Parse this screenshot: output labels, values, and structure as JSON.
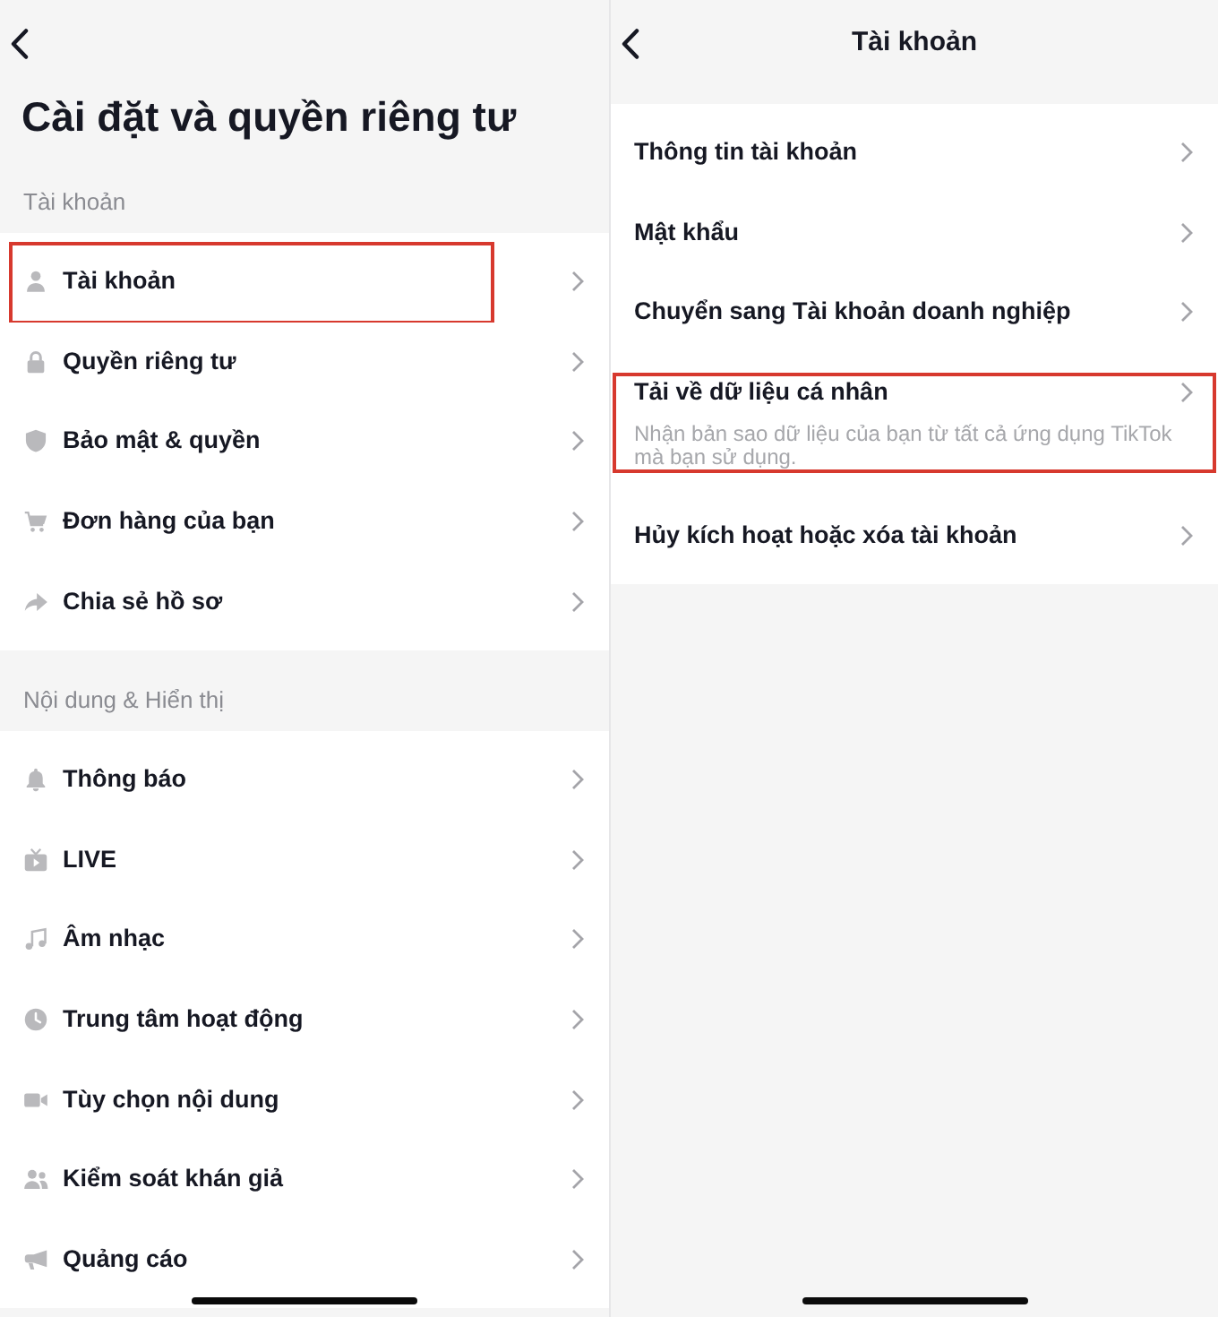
{
  "left_screen": {
    "title": "Cài đặt và quyền riêng tư",
    "sections": [
      {
        "header": "Tài khoản",
        "items": [
          {
            "kind": "account",
            "label": "Tài khoản",
            "highlighted": true
          },
          {
            "kind": "privacy",
            "label": "Quyền riêng tư",
            "highlighted": false
          },
          {
            "kind": "security",
            "label": "Bảo mật & quyền",
            "highlighted": false
          },
          {
            "kind": "orders",
            "label": "Đơn hàng của bạn",
            "highlighted": false
          },
          {
            "kind": "share",
            "label": "Chia sẻ hồ sơ",
            "highlighted": false
          }
        ]
      },
      {
        "header": "Nội dung & Hiển thị",
        "items": [
          {
            "kind": "notifications",
            "label": "Thông báo",
            "highlighted": false
          },
          {
            "kind": "live",
            "label": "LIVE",
            "highlighted": false
          },
          {
            "kind": "music",
            "label": "Âm nhạc",
            "highlighted": false
          },
          {
            "kind": "activity",
            "label": "Trung tâm hoạt động",
            "highlighted": false
          },
          {
            "kind": "content",
            "label": "Tùy chọn nội dung",
            "highlighted": false
          },
          {
            "kind": "audience",
            "label": "Kiểm soát khán giả",
            "highlighted": false
          },
          {
            "kind": "ads",
            "label": "Quảng cáo",
            "highlighted": false
          }
        ]
      }
    ]
  },
  "right_screen": {
    "title": "Tài khoản",
    "items": [
      {
        "label": "Thông tin tài khoản",
        "highlighted": false
      },
      {
        "label": "Mật khẩu",
        "highlighted": false
      },
      {
        "label": "Chuyển sang Tài khoản doanh nghiệp",
        "highlighted": false
      },
      {
        "label": "Tải về dữ liệu cá nhân",
        "description": "Nhận bản sao dữ liệu của bạn từ tất cả ứng dụng TikTok mà bạn sử dụng.",
        "highlighted": true
      },
      {
        "label": "Hủy kích hoạt hoặc xóa tài khoản",
        "highlighted": false
      }
    ]
  }
}
